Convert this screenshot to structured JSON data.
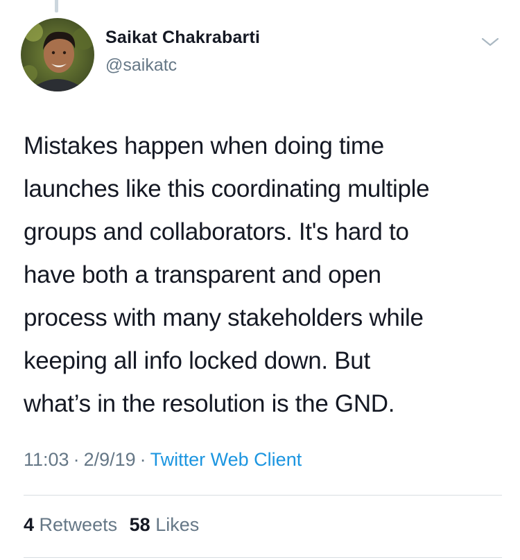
{
  "author": {
    "name": "Saikat Chakrabarti",
    "handle": "@saikatc"
  },
  "tweet": {
    "text": "Mistakes happen when doing time\nlaunches like this coordinating multiple\ngroups and collaborators. It's hard to\nhave both a transparent and open\nprocess with many stakeholders while\nkeeping all info locked down. But\nwhat’s in the resolution is the GND.",
    "time": "11:03",
    "date": "2/9/19",
    "source": "Twitter Web Client",
    "separator": "·"
  },
  "stats": {
    "retweets_count": "4",
    "retweets_label": "Retweets",
    "likes_count": "58",
    "likes_label": "Likes"
  },
  "icons": {
    "menu": "chevron-down-icon",
    "avatar": "avatar"
  },
  "colors": {
    "link": "#1b95e0",
    "secondary_text": "#657786",
    "primary_text": "#141823",
    "divider": "#d8dde1"
  }
}
